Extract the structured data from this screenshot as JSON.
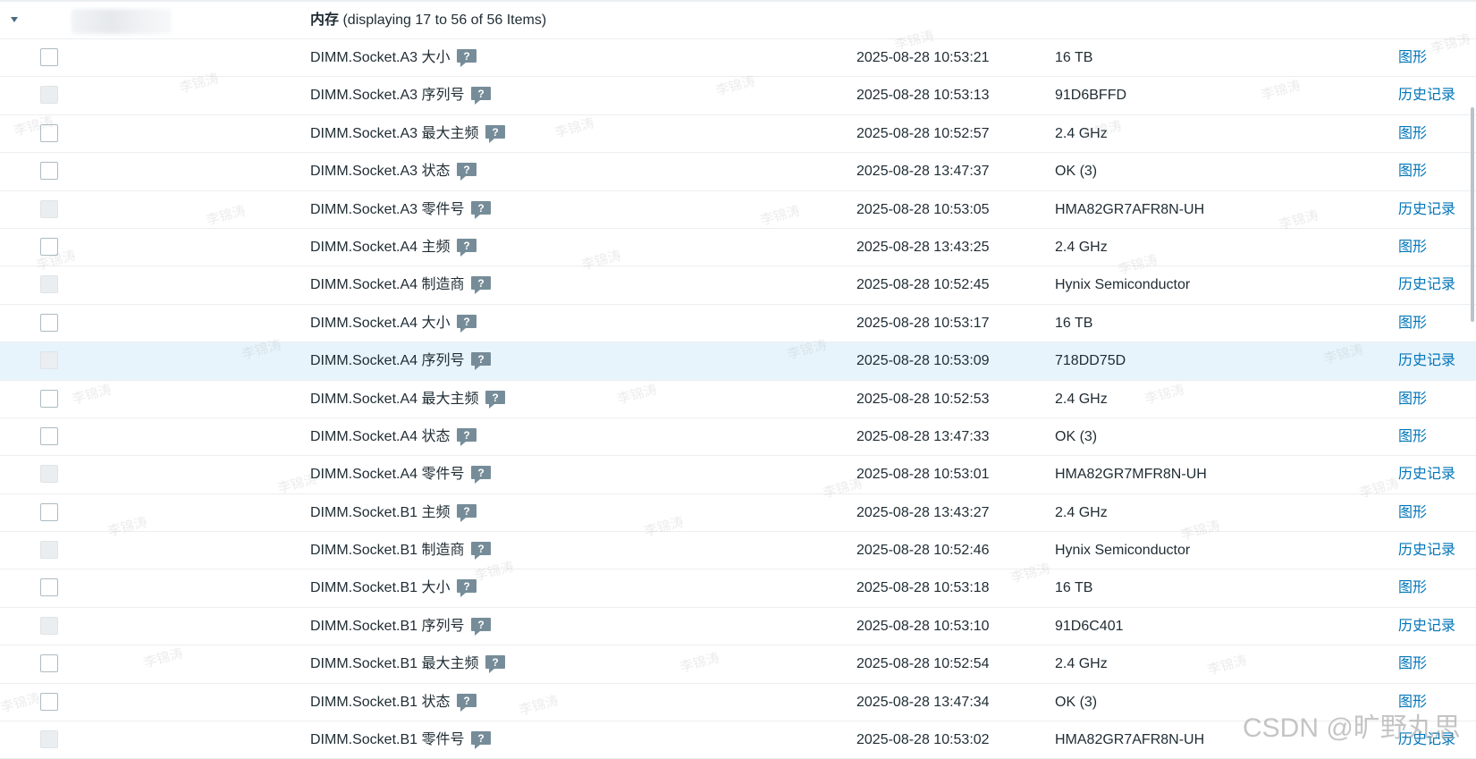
{
  "group": {
    "name": "内存",
    "summary": "(displaying 17 to 56 of 56 Items)"
  },
  "items": [
    {
      "name": "DIMM.Socket.A3 大小",
      "time": "2025-08-28 10:53:21",
      "value": "16 TB",
      "action": "图形",
      "checkbox_disabled": false,
      "highlight": false
    },
    {
      "name": "DIMM.Socket.A3 序列号",
      "time": "2025-08-28 10:53:13",
      "value": "91D6BFFD",
      "action": "历史记录",
      "checkbox_disabled": true,
      "highlight": false
    },
    {
      "name": "DIMM.Socket.A3 最大主频",
      "time": "2025-08-28 10:52:57",
      "value": "2.4 GHz",
      "action": "图形",
      "checkbox_disabled": false,
      "highlight": false
    },
    {
      "name": "DIMM.Socket.A3 状态",
      "time": "2025-08-28 13:47:37",
      "value": "OK (3)",
      "action": "图形",
      "checkbox_disabled": false,
      "highlight": false
    },
    {
      "name": "DIMM.Socket.A3 零件号",
      "time": "2025-08-28 10:53:05",
      "value": "HMA82GR7AFR8N-UH",
      "action": "历史记录",
      "checkbox_disabled": true,
      "highlight": false
    },
    {
      "name": "DIMM.Socket.A4 主频",
      "time": "2025-08-28 13:43:25",
      "value": "2.4 GHz",
      "action": "图形",
      "checkbox_disabled": false,
      "highlight": false
    },
    {
      "name": "DIMM.Socket.A4 制造商",
      "time": "2025-08-28 10:52:45",
      "value": "Hynix Semiconductor",
      "action": "历史记录",
      "checkbox_disabled": true,
      "highlight": false
    },
    {
      "name": "DIMM.Socket.A4 大小",
      "time": "2025-08-28 10:53:17",
      "value": "16 TB",
      "action": "图形",
      "checkbox_disabled": false,
      "highlight": false
    },
    {
      "name": "DIMM.Socket.A4 序列号",
      "time": "2025-08-28 10:53:09",
      "value": "718DD75D",
      "action": "历史记录",
      "checkbox_disabled": true,
      "highlight": true
    },
    {
      "name": "DIMM.Socket.A4 最大主频",
      "time": "2025-08-28 10:52:53",
      "value": "2.4 GHz",
      "action": "图形",
      "checkbox_disabled": false,
      "highlight": false
    },
    {
      "name": "DIMM.Socket.A4 状态",
      "time": "2025-08-28 13:47:33",
      "value": "OK (3)",
      "action": "图形",
      "checkbox_disabled": false,
      "highlight": false
    },
    {
      "name": "DIMM.Socket.A4 零件号",
      "time": "2025-08-28 10:53:01",
      "value": "HMA82GR7MFR8N-UH",
      "action": "历史记录",
      "checkbox_disabled": true,
      "highlight": false
    },
    {
      "name": "DIMM.Socket.B1 主频",
      "time": "2025-08-28 13:43:27",
      "value": "2.4 GHz",
      "action": "图形",
      "checkbox_disabled": false,
      "highlight": false
    },
    {
      "name": "DIMM.Socket.B1 制造商",
      "time": "2025-08-28 10:52:46",
      "value": "Hynix Semiconductor",
      "action": "历史记录",
      "checkbox_disabled": true,
      "highlight": false
    },
    {
      "name": "DIMM.Socket.B1 大小",
      "time": "2025-08-28 10:53:18",
      "value": "16 TB",
      "action": "图形",
      "checkbox_disabled": false,
      "highlight": false
    },
    {
      "name": "DIMM.Socket.B1 序列号",
      "time": "2025-08-28 10:53:10",
      "value": "91D6C401",
      "action": "历史记录",
      "checkbox_disabled": true,
      "highlight": false
    },
    {
      "name": "DIMM.Socket.B1 最大主频",
      "time": "2025-08-28 10:52:54",
      "value": "2.4 GHz",
      "action": "图形",
      "checkbox_disabled": false,
      "highlight": false
    },
    {
      "name": "DIMM.Socket.B1 状态",
      "time": "2025-08-28 13:47:34",
      "value": "OK (3)",
      "action": "图形",
      "checkbox_disabled": false,
      "highlight": false
    },
    {
      "name": "DIMM.Socket.B1 零件号",
      "time": "2025-08-28 10:53:02",
      "value": "HMA82GR7AFR8N-UH",
      "action": "历史记录",
      "checkbox_disabled": true,
      "highlight": false
    }
  ],
  "watermark_text": "李锦涛",
  "csdn_watermark": "CSDN @旷野丸思",
  "colors": {
    "link": "#0275b8",
    "highlight_row": "#e8f4fc",
    "hint_icon": "#768d99",
    "row_border": "#ebeef0"
  },
  "icons": {
    "toggle": "triangle-down-icon",
    "hint": "help-speech-bubble-icon"
  }
}
